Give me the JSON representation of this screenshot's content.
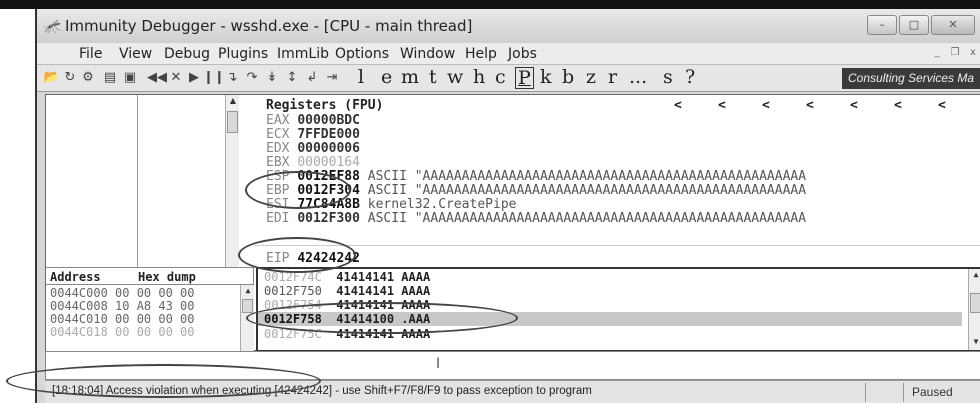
{
  "window": {
    "title": "Immunity Debugger - wsshd.exe - [CPU - main thread]",
    "buttons": {
      "minimize": "–",
      "maximize": "□",
      "close": "✕"
    }
  },
  "menu": {
    "items": [
      "File",
      "View",
      "Debug",
      "Plugins",
      "ImmLib",
      "Options",
      "Window",
      "Help",
      "Jobs"
    ],
    "mdi_buttons": [
      "_",
      "̅",
      "x"
    ]
  },
  "toolbar": {
    "icons": [
      "open-icon",
      "restart-icon",
      "plugin-icon",
      "window-icon",
      "terminal-icon",
      "rewind-icon",
      "close-icon",
      "play-icon",
      "pause-icon",
      "step-into-icon",
      "step-over-icon",
      "trace-into-icon",
      "trace-over-icon",
      "execute-till-return-icon",
      "go-to-icon"
    ],
    "letters": [
      "l",
      "e",
      "m",
      "t",
      "w",
      "h",
      "c",
      "P",
      "k",
      "b",
      "z",
      "r",
      "...",
      "s",
      "?"
    ],
    "consulting_label": "Consulting Services Ma"
  },
  "registers": {
    "title": "Registers (FPU)",
    "arrows": [
      "<",
      "<",
      "<",
      "<",
      "<",
      "<",
      "<"
    ],
    "rows": [
      {
        "name": "EAX",
        "value": "00000BDC",
        "comment": ""
      },
      {
        "name": "ECX",
        "value": "7FFDE000",
        "comment": ""
      },
      {
        "name": "EDX",
        "value": "00000006",
        "comment": ""
      },
      {
        "name": "EBX",
        "value": "00000164",
        "comment": ""
      },
      {
        "name": "ESP",
        "value": "0012EF88",
        "comment": "ASCII \"AAAAAAAAAAAAAAAAAAAAAAAAAAAAAAAAAAAAAAAAAAAAAAAAA"
      },
      {
        "name": "EBP",
        "value": "0012F304",
        "comment": "ASCII \"AAAAAAAAAAAAAAAAAAAAAAAAAAAAAAAAAAAAAAAAAAAAAAAAA"
      },
      {
        "name": "ESI",
        "value": "77C84A8B",
        "comment": "kernel32.CreatePipe"
      },
      {
        "name": "EDI",
        "value": "0012F300",
        "comment": "ASCII \"AAAAAAAAAAAAAAAAAAAAAAAAAAAAAAAAAAAAAAAAAAAAAAAAA"
      }
    ],
    "eip": {
      "name": "EIP",
      "value": "42424242"
    }
  },
  "hexdump": {
    "headers": [
      "Address",
      "Hex dump"
    ],
    "rows": [
      "0044C000 00 00 00 00",
      "0044C008 10 A8 43 00",
      "0044C010 00 00 00 00",
      "0044C018 00 00 00 00"
    ]
  },
  "stack": {
    "rows": [
      {
        "addr": "0012F74C",
        "value": "41414141",
        "ascii": "AAAA"
      },
      {
        "addr": "0012F750",
        "value": "41414141",
        "ascii": "AAAA"
      },
      {
        "addr": "0012F754",
        "value": "41414141",
        "ascii": "AAAA"
      },
      {
        "addr": "0012F758",
        "value": "41414100",
        "ascii": ".AAA"
      },
      {
        "addr": "0012F75C",
        "value": "41414141",
        "ascii": "AAAA"
      }
    ]
  },
  "command": {
    "cursor": "I"
  },
  "status": {
    "message": "[18:18:04] Access violation when executing [42424242] - use Shift+F7/F8/F9 to pass exception to program",
    "state": "Paused"
  }
}
